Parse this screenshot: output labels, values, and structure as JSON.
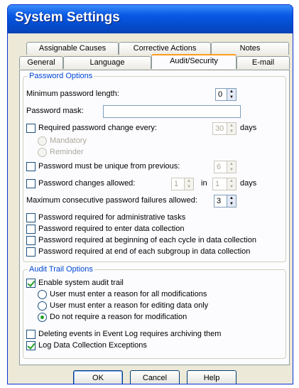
{
  "window": {
    "title": "System Settings"
  },
  "tabs": {
    "row1": [
      "Assignable Causes",
      "Corrective Actions",
      "Notes"
    ],
    "row2": [
      "General",
      "Language",
      "Audit/Security",
      "E-mail"
    ],
    "active": "Audit/Security"
  },
  "password_options": {
    "title": "Password Options",
    "min_length_label": "Minimum password length:",
    "min_length_value": "0",
    "mask_label": "Password mask:",
    "mask_value": "",
    "req_change_label": "Required password change every:",
    "req_change_checked": false,
    "req_change_value": "30",
    "days_label": "days",
    "mandatory_label": "Mandatory",
    "reminder_label": "Reminder",
    "unique_label": "Password must be unique from previous:",
    "unique_checked": false,
    "unique_value": "6",
    "changes_allowed_label": "Password changes allowed:",
    "changes_allowed_checked": false,
    "changes_value": "1",
    "in_label": "in",
    "changes_days_value": "1",
    "max_failures_label": "Maximum consecutive password failures allowed:",
    "max_failures_value": "3",
    "checkboxes": [
      {
        "label": "Password required for administrative tasks",
        "checked": false
      },
      {
        "label": "Password required to enter data collection",
        "checked": false
      },
      {
        "label": "Password required at beginning of each cycle in data collection",
        "checked": false
      },
      {
        "label": "Password required at end of each subgroup in data collection",
        "checked": false
      }
    ]
  },
  "audit_trail": {
    "title": "Audit Trail Options",
    "enable_label": "Enable system audit trail",
    "enable_checked": true,
    "radios": [
      {
        "label": "User must enter a reason for all modifications",
        "selected": false
      },
      {
        "label": "User must enter a reason for editing data only",
        "selected": false
      },
      {
        "label": "Do not require a reason for modification",
        "selected": true
      }
    ],
    "delete_events_label": "Deleting events in Event Log requires archiving them",
    "delete_events_checked": false,
    "log_exceptions_label": "Log Data Collection Exceptions",
    "log_exceptions_checked": true
  },
  "buttons": {
    "ok": "OK",
    "cancel": "Cancel",
    "help": "Help"
  }
}
